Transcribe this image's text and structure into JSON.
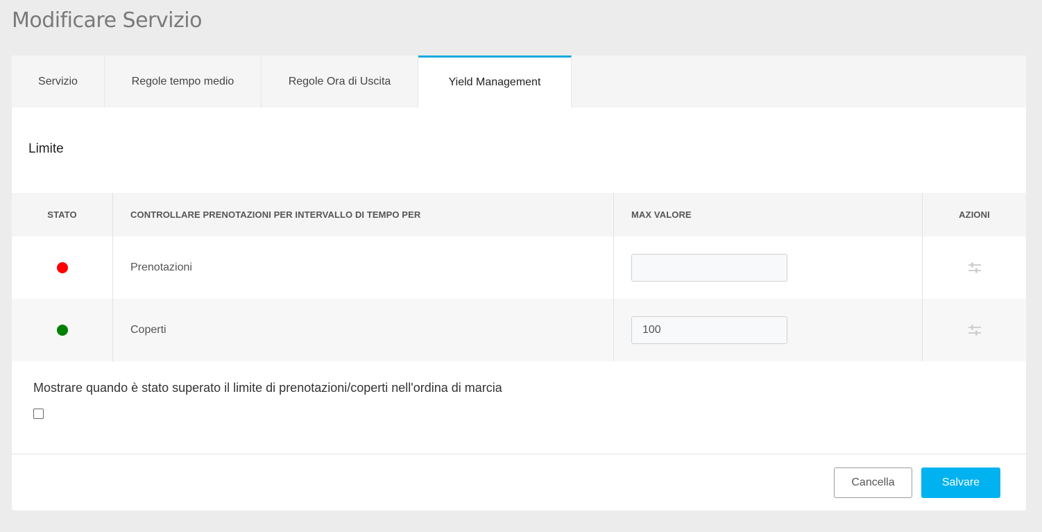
{
  "page": {
    "title": "Modificare Servizio"
  },
  "tabs": [
    {
      "label": "Servizio",
      "active": false
    },
    {
      "label": "Regole tempo medio",
      "active": false
    },
    {
      "label": "Regole Ora di Uscita",
      "active": false
    },
    {
      "label": "Yield Management",
      "active": true
    }
  ],
  "section": {
    "title": "Limite"
  },
  "table": {
    "headers": {
      "stato": "STATO",
      "control": "CONTROLLARE PRENOTAZIONI PER INTERVALLO DI TEMPO PER",
      "max": "MAX VALORE",
      "azioni": "AZIONI"
    },
    "rows": [
      {
        "status_color": "#ff0000",
        "label": "Prenotazioni",
        "max_value": "",
        "action_icon": "sliders-icon"
      },
      {
        "status_color": "#008000",
        "label": "Coperti",
        "max_value": "100",
        "action_icon": "sliders-icon"
      }
    ]
  },
  "option": {
    "label": "Mostrare quando è stato superato il limite di prenotazioni/coperti nell'ordina di marcia",
    "checked": false
  },
  "buttons": {
    "cancel": "Cancella",
    "save": "Salvare"
  },
  "colors": {
    "accent": "#00b2ef",
    "tab_active_border": "#12a9dd"
  }
}
